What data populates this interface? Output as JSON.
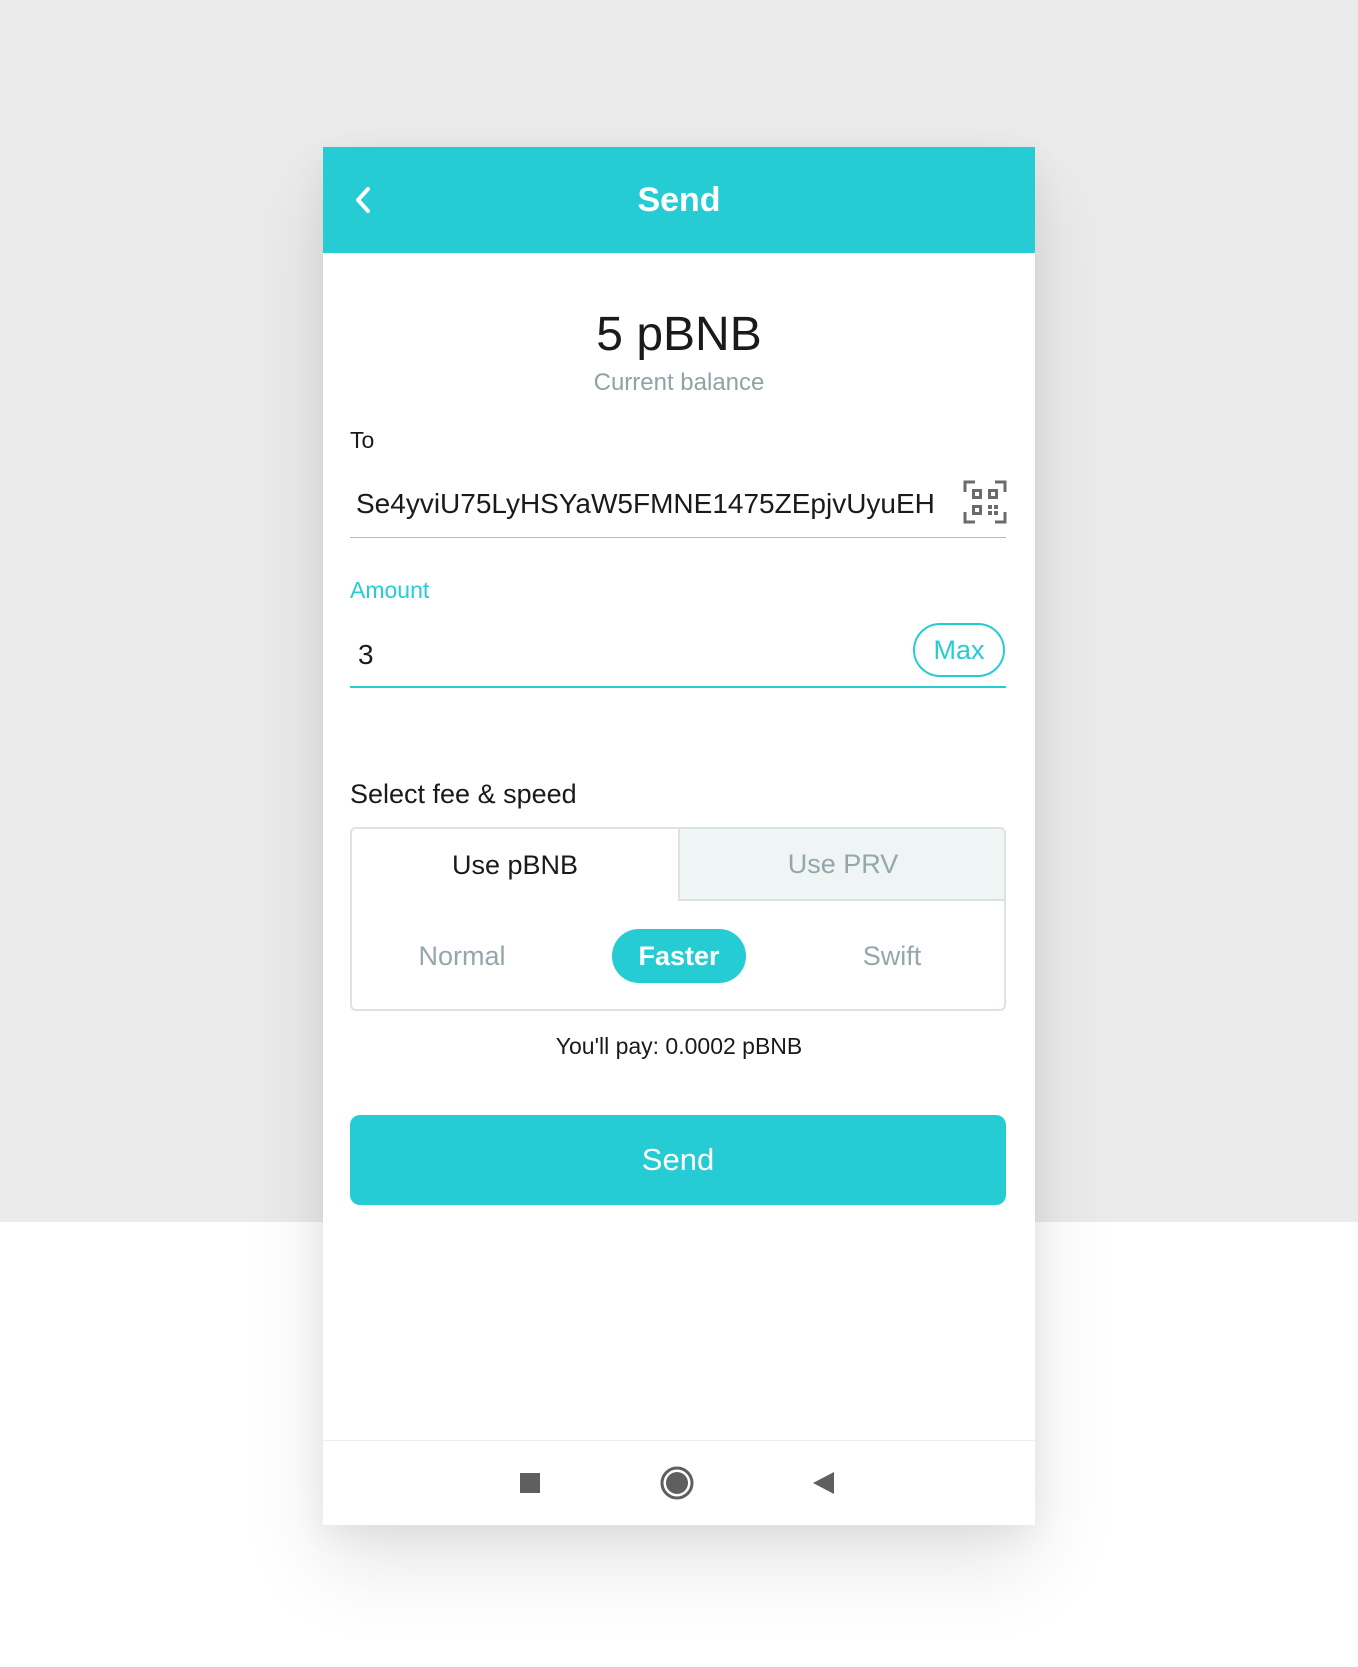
{
  "header": {
    "title": "Send",
    "back_icon": "chevron-left-icon"
  },
  "balance": {
    "amount": "5 pBNB",
    "label": "Current balance"
  },
  "to_field": {
    "label": "To",
    "value": "Se4yviU75LyHSYaW5FMNE1475ZEpjvUyuEH",
    "qr_icon": "qr-scan-icon"
  },
  "amount_field": {
    "label": "Amount",
    "value": "3",
    "max_label": "Max"
  },
  "fee": {
    "title": "Select fee & speed",
    "tabs": [
      {
        "label": "Use pBNB",
        "active": true
      },
      {
        "label": "Use PRV",
        "active": false
      }
    ],
    "speeds": [
      {
        "label": "Normal",
        "selected": false
      },
      {
        "label": "Faster",
        "selected": true
      },
      {
        "label": "Swift",
        "selected": false
      }
    ],
    "you_pay": "You'll pay: 0.0002 pBNB"
  },
  "send_button": {
    "label": "Send"
  },
  "nav_bar": {
    "icons": [
      "square-icon",
      "home-circle-icon",
      "back-triangle-icon"
    ]
  },
  "colors": {
    "accent": "#25ccd4",
    "muted_text": "#94a7aa",
    "background": "#ebebeb"
  }
}
